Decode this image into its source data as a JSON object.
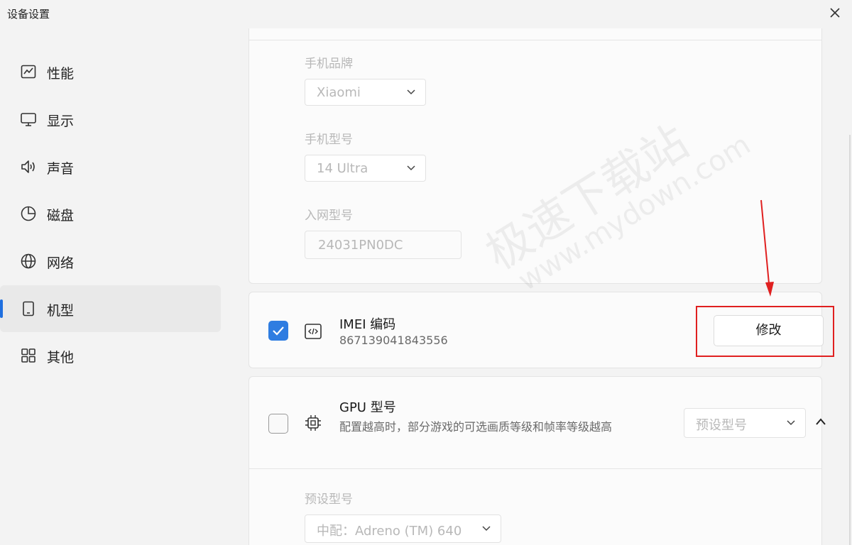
{
  "window": {
    "title": "设备设置"
  },
  "sidebar": {
    "items": [
      {
        "label": "性能",
        "icon": "chart-icon",
        "active": false
      },
      {
        "label": "显示",
        "icon": "monitor-icon",
        "active": false
      },
      {
        "label": "声音",
        "icon": "speaker-icon",
        "active": false
      },
      {
        "label": "磁盘",
        "icon": "pie-icon",
        "active": false
      },
      {
        "label": "网络",
        "icon": "globe-icon",
        "active": false
      },
      {
        "label": "机型",
        "icon": "phone-icon",
        "active": true
      },
      {
        "label": "其他",
        "icon": "grid-icon",
        "active": false
      }
    ]
  },
  "phone": {
    "brand_label": "手机品牌",
    "brand_value": "Xiaomi",
    "model_label": "手机型号",
    "model_value": "14 Ultra",
    "netmodel_label": "入网型号",
    "netmodel_value": "24031PN0DC"
  },
  "imei": {
    "checked": true,
    "title": "IMEI 编码",
    "value": "867139041843556",
    "button_label": "修改"
  },
  "gpu": {
    "checked": false,
    "title": "GPU 型号",
    "subtitle": "配置越高时，部分游戏的可选画质等级和帧率等级越高",
    "select_value": "预设型号",
    "preset_label": "预设型号",
    "preset_value": "中配：Adreno (TM) 640"
  },
  "watermark": {
    "cn": "极速下载站",
    "en": "www.mydown.com"
  },
  "colors": {
    "accent": "#2f7de1",
    "highlight": "#e02020"
  }
}
